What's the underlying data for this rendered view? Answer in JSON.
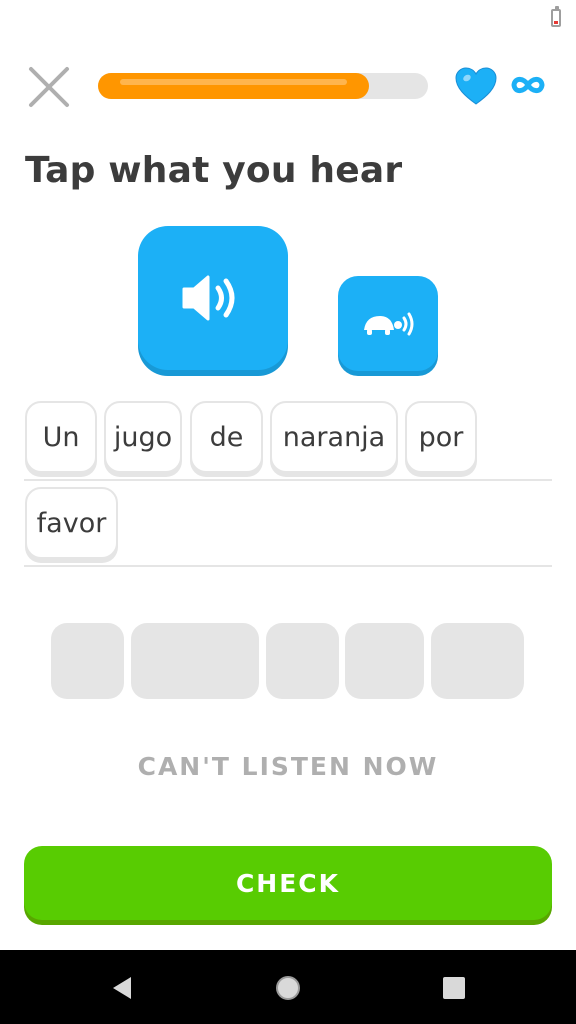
{
  "lesson": {
    "progress": 0.82,
    "lives": "∞",
    "instruction": "Tap what you hear",
    "audio_icon": "speaker-icon",
    "slow_audio_icon": "turtle-icon"
  },
  "answer_tiles": [
    "Un",
    "jugo",
    "de",
    "naranja",
    "por",
    "favor"
  ],
  "word_bank_slots": 5,
  "cant_listen_label": "CAN'T LISTEN NOW",
  "check_label": "CHECK",
  "colors": {
    "progress": "#ff9600",
    "audio": "#1cb0f6",
    "heart": "#1cb0f6",
    "check": "#58cc02",
    "muted": "#afafaf"
  }
}
